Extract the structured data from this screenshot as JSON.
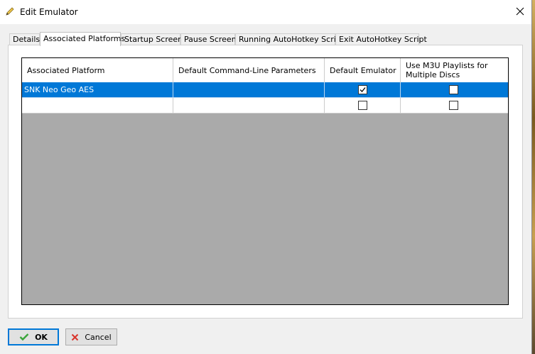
{
  "window": {
    "title": "Edit Emulator"
  },
  "tabs": [
    {
      "label": "Details"
    },
    {
      "label": "Associated Platforms"
    },
    {
      "label": "Startup Screen"
    },
    {
      "label": "Pause Screen"
    },
    {
      "label": "Running AutoHotkey Script"
    },
    {
      "label": "Exit AutoHotkey Script"
    }
  ],
  "grid": {
    "columns": [
      {
        "label": "Associated Platform"
      },
      {
        "label": "Default Command-Line Parameters"
      },
      {
        "label": "Default Emulator"
      },
      {
        "label": "Use M3U Playlists for Multiple Discs"
      }
    ],
    "rows": [
      {
        "platform": "SNK Neo Geo AES",
        "parameters": "",
        "default_emulator": true,
        "use_m3u": false,
        "selected": true
      },
      {
        "platform": "",
        "parameters": "",
        "default_emulator": false,
        "use_m3u": false,
        "selected": false
      }
    ]
  },
  "buttons": {
    "ok_label": "OK",
    "cancel_label": "Cancel"
  },
  "colors": {
    "selection": "#0078d7",
    "grid_background": "#aaaaaa",
    "ok_icon": "#3aa53a",
    "cancel_icon": "#d9342b"
  },
  "icons": {
    "title": "pencil-icon",
    "close": "close-icon",
    "ok": "checkmark-icon",
    "cancel": "x-icon"
  }
}
